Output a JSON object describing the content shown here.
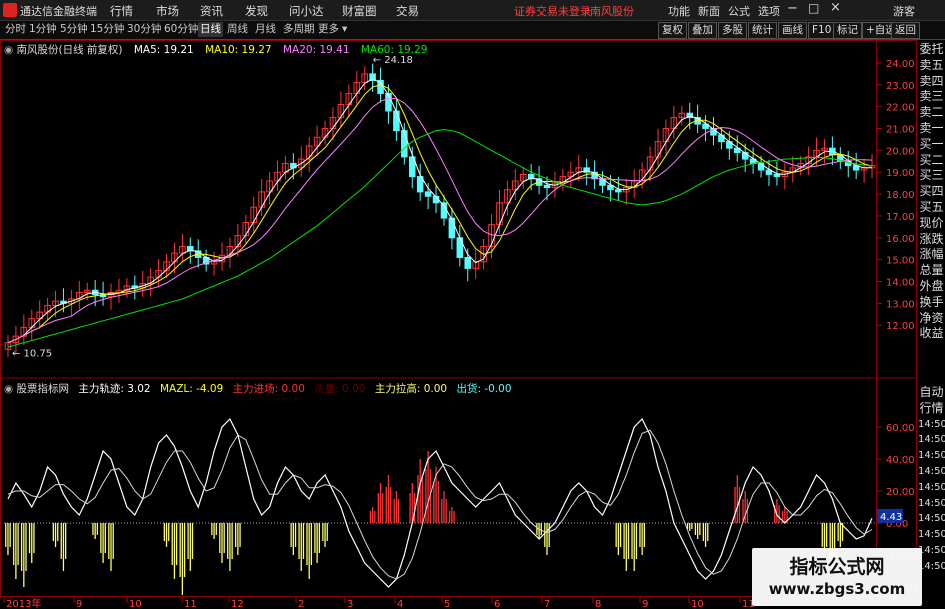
{
  "menubar": {
    "app_title": "通达信金融终端",
    "items": [
      "行情",
      "市场",
      "资讯",
      "发现",
      "问小达",
      "财富圈",
      "交易"
    ],
    "status_text": "证券交易未登录",
    "stock_name": "南风股份",
    "right_items": [
      "功能",
      "新面",
      "公式",
      "选项"
    ],
    "guest": "游客"
  },
  "toolbar": {
    "periods": [
      "分时",
      "1分钟",
      "5分钟",
      "15分钟",
      "30分钟",
      "60分钟",
      "日线",
      "周线",
      "月线",
      "多周期",
      "更多"
    ],
    "active_period": "日线",
    "right_buttons": [
      "复权",
      "叠加",
      "多股",
      "统计",
      "画线",
      "F10",
      "标记",
      "+自选",
      "返回"
    ]
  },
  "main_legend": {
    "title": "南风股份(日线 前复权)",
    "ma5": "MA5: 19.21",
    "ma10": "MA10: 19.27",
    "ma20": "MA20: 19.41",
    "ma60": "MA60: 19.29"
  },
  "price_labels": {
    "high": "24.18",
    "low": "10.75"
  },
  "sub_legend": {
    "title": "股票指标网",
    "zlgj": "主力轨迹: 3.02",
    "mazl": "MAZL: -4.09",
    "jc": "主力进场: 0.00",
    "xf": "洗盘: 0.00",
    "lg": "主力拉高: 0.00",
    "ch": "出货: -0.00"
  },
  "current_value": "4.43",
  "right_panel": {
    "top": [
      "委托",
      "卖五",
      "卖四",
      "卖三",
      "卖二",
      "卖一",
      "买一",
      "买二",
      "买三",
      "买四",
      "买五",
      "现价",
      "涨跌",
      "涨幅",
      "总量",
      "外盘",
      "换手",
      "净资",
      "收益"
    ],
    "bottom": [
      "自动",
      "行情",
      "14:50",
      "14:50",
      "14:50",
      "14:50",
      "14:50",
      "14:50",
      "14:50",
      "14:50",
      "14:50",
      "14:50"
    ]
  },
  "watermark": {
    "line1": "指标公式网",
    "line2": "www.zbgs3.com"
  },
  "colors": {
    "up": "#ff3232",
    "down": "#54fcfc",
    "yellow": "#ffff66",
    "ma5": "#ffffff",
    "ma10": "#ffff00",
    "ma20": "#ff80ff",
    "ma60": "#00e600"
  },
  "chart_data": [
    {
      "type": "candlestick",
      "title": "南风股份(日线 前复权)",
      "ylim": [
        10.5,
        24.5
      ],
      "yticks": [
        12,
        13,
        14,
        15,
        16,
        17,
        18,
        19,
        20,
        21,
        22,
        23,
        24
      ],
      "ytick_labels": [
        "12.00",
        "13.00",
        "14.00",
        "15.00",
        "16.00",
        "17.00",
        "18.00",
        "19.00",
        "20.00",
        "21.00",
        "22.00",
        "23.00",
        "24.00"
      ],
      "close": [
        11.2,
        11.5,
        11.9,
        12.3,
        12.6,
        12.9,
        13.1,
        13.0,
        13.2,
        13.5,
        13.6,
        13.4,
        13.3,
        13.5,
        13.6,
        13.8,
        13.7,
        13.9,
        14.2,
        14.5,
        14.9,
        15.3,
        15.6,
        15.4,
        15.1,
        14.8,
        14.9,
        15.2,
        15.6,
        16.1,
        16.7,
        17.4,
        18.1,
        18.6,
        19.0,
        19.4,
        19.2,
        19.6,
        20.2,
        20.6,
        21.0,
        21.5,
        22.1,
        22.6,
        23.1,
        23.5,
        23.2,
        22.6,
        21.8,
        20.9,
        19.7,
        18.8,
        18.1,
        17.9,
        17.6,
        16.9,
        16.0,
        15.1,
        14.6,
        14.9,
        15.6,
        16.6,
        17.6,
        18.2,
        18.6,
        18.9,
        18.7,
        18.4,
        18.3,
        18.5,
        18.8,
        19.0,
        19.2,
        19.0,
        18.7,
        18.4,
        18.2,
        18.1,
        18.3,
        18.6,
        19.1,
        19.7,
        20.4,
        21.0,
        21.5,
        21.7,
        21.5,
        21.2,
        21.0,
        20.7,
        20.4,
        20.1,
        19.9,
        19.6,
        19.4,
        19.1,
        18.9,
        18.8,
        19.0,
        19.2,
        19.4,
        19.7,
        20.0,
        20.1,
        19.8,
        19.5,
        19.3,
        19.1,
        19.2,
        19.3
      ],
      "ma60": [
        11.0,
        11.1,
        11.2,
        11.3,
        11.4,
        11.5,
        11.6,
        11.7,
        11.8,
        11.9,
        12.0,
        12.1,
        12.2,
        12.3,
        12.4,
        12.5,
        12.6,
        12.7,
        12.8,
        12.9,
        13.0,
        13.1,
        13.2,
        13.35,
        13.5,
        13.65,
        13.8,
        13.95,
        14.1,
        14.25,
        14.45,
        14.65,
        14.85,
        15.05,
        15.3,
        15.55,
        15.8,
        16.05,
        16.3,
        16.55,
        16.85,
        17.15,
        17.45,
        17.75,
        18.05,
        18.35,
        18.7,
        19.05,
        19.4,
        19.75,
        20.1,
        20.4,
        20.6,
        20.75,
        20.9,
        20.95,
        20.9,
        20.8,
        20.6,
        20.4,
        20.2,
        20.0,
        19.8,
        19.6,
        19.4,
        19.2,
        19.0,
        18.85,
        18.7,
        18.55,
        18.4,
        18.3,
        18.2,
        18.1,
        18.0,
        17.9,
        17.8,
        17.7,
        17.6,
        17.55,
        17.5,
        17.55,
        17.6,
        17.7,
        17.85,
        18.0,
        18.2,
        18.4,
        18.6,
        18.8,
        18.95,
        19.1,
        19.2,
        19.3,
        19.4,
        19.45,
        19.5,
        19.55,
        19.6,
        19.62,
        19.64,
        19.66,
        19.68,
        19.66,
        19.62,
        19.55,
        19.45,
        19.38,
        19.33,
        19.29
      ]
    },
    {
      "type": "line+bar",
      "title": "股票指标网",
      "ylim": [
        -45,
        80
      ],
      "yticks": [
        60,
        40,
        20,
        0,
        -20,
        -40
      ],
      "ytick_labels": [
        "60.00",
        "40.00",
        "20.00",
        "0.00",
        "-20.00",
        "-40.00"
      ],
      "zlgj": [
        15,
        25,
        18,
        10,
        20,
        35,
        30,
        18,
        10,
        5,
        15,
        30,
        45,
        40,
        25,
        10,
        5,
        15,
        35,
        50,
        55,
        48,
        35,
        20,
        10,
        25,
        45,
        60,
        65,
        55,
        35,
        15,
        5,
        10,
        25,
        35,
        30,
        20,
        15,
        25,
        30,
        20,
        10,
        -5,
        -15,
        -25,
        -30,
        -35,
        -40,
        -35,
        -20,
        0,
        25,
        40,
        45,
        35,
        25,
        20,
        15,
        10,
        15,
        20,
        25,
        15,
        5,
        0,
        -5,
        -10,
        -5,
        0,
        10,
        20,
        25,
        20,
        10,
        5,
        15,
        30,
        45,
        60,
        65,
        55,
        35,
        20,
        0,
        -10,
        -20,
        -30,
        -35,
        -30,
        -20,
        -5,
        10,
        25,
        35,
        30,
        20,
        5,
        0,
        5,
        10,
        20,
        30,
        25,
        15,
        0,
        -5,
        -10,
        -8,
        3.02
      ],
      "mazl": [
        18,
        20,
        20,
        17,
        16,
        20,
        24,
        24,
        20,
        15,
        12,
        16,
        25,
        33,
        34,
        28,
        20,
        15,
        18,
        28,
        38,
        45,
        45,
        38,
        28,
        20,
        22,
        33,
        47,
        55,
        52,
        40,
        27,
        18,
        18,
        25,
        30,
        28,
        22,
        22,
        24,
        23,
        19,
        11,
        0,
        -11,
        -21,
        -28,
        -33,
        -35,
        -32,
        -22,
        -6,
        13,
        30,
        37,
        35,
        29,
        22,
        16,
        14,
        15,
        18,
        18,
        13,
        6,
        0,
        -4,
        -6,
        -4,
        2,
        10,
        17,
        20,
        18,
        13,
        11,
        18,
        30,
        44,
        56,
        58,
        50,
        37,
        20,
        5,
        -8,
        -19,
        -28,
        -32,
        -30,
        -22,
        -10,
        5,
        18,
        25,
        25,
        19,
        10,
        5,
        5,
        10,
        17,
        21,
        19,
        12,
        4,
        -3,
        -7,
        -4.09
      ],
      "signal": [
        -20,
        -35,
        -40,
        -25,
        0,
        0,
        -15,
        -30,
        0,
        0,
        0,
        -10,
        -25,
        -30,
        0,
        0,
        0,
        0,
        0,
        0,
        -15,
        -35,
        -45,
        -30,
        0,
        0,
        -10,
        -25,
        -30,
        -20,
        0,
        0,
        0,
        0,
        0,
        0,
        -20,
        -30,
        -35,
        -25,
        -15,
        0,
        0,
        0,
        0,
        0,
        10,
        25,
        30,
        20,
        0,
        25,
        40,
        45,
        35,
        20,
        10,
        0,
        0,
        0,
        0,
        0,
        0,
        0,
        0,
        0,
        0,
        -10,
        -20,
        0,
        0,
        0,
        0,
        0,
        0,
        0,
        0,
        -20,
        -30,
        -30,
        -20,
        0,
        0,
        0,
        0,
        0,
        -5,
        -10,
        -15,
        0,
        0,
        0,
        30,
        20,
        0,
        0,
        0,
        15,
        10,
        0,
        0,
        0,
        0,
        -20,
        -30,
        -15,
        0,
        0,
        0,
        0
      ]
    }
  ],
  "x_axis_labels": [
    "2013年",
    "9",
    "10",
    "11",
    "12",
    "2",
    "3",
    "4",
    "5",
    "6",
    "7",
    "8",
    "9",
    "10",
    "11"
  ]
}
